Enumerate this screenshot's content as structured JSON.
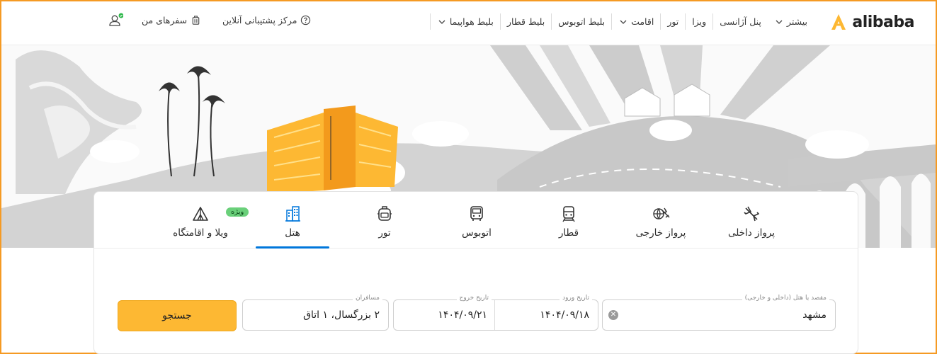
{
  "brand": {
    "name": "alibaba",
    "accent": "#fdb833"
  },
  "nav": {
    "items": [
      {
        "label": "بلیط هواپیما",
        "dropdown": true
      },
      {
        "label": "بلیط قطار",
        "dropdown": false
      },
      {
        "label": "بلیط اتوبوس",
        "dropdown": false
      },
      {
        "label": "اقامت",
        "dropdown": true
      },
      {
        "label": "تور",
        "dropdown": false
      },
      {
        "label": "ویزا",
        "dropdown": false
      },
      {
        "label": "پنل آژانسی",
        "dropdown": false
      },
      {
        "label": "بیشتر",
        "dropdown": true
      }
    ],
    "support": "مرکز پشتیبانی آنلاین",
    "trips": "سفرهای من"
  },
  "tabs": [
    {
      "id": "domestic-flight",
      "label": "پرواز داخلی",
      "icon": "plane-icon"
    },
    {
      "id": "international-flight",
      "label": "پرواز خارجی",
      "icon": "globe-plane-icon"
    },
    {
      "id": "train",
      "label": "قطار",
      "icon": "train-icon"
    },
    {
      "id": "bus",
      "label": "اتوبوس",
      "icon": "bus-icon"
    },
    {
      "id": "tour",
      "label": "تور",
      "icon": "backpack-icon"
    },
    {
      "id": "hotel",
      "label": "هتل",
      "icon": "hotel-building-icon",
      "active": true
    },
    {
      "id": "villa",
      "label": "ویلا و اقامتگاه",
      "icon": "tent-icon",
      "badge": "ویژه"
    }
  ],
  "form": {
    "destination": {
      "label": "مقصد یا هتل (داخلی و خارجی)",
      "value": "مشهد"
    },
    "checkin": {
      "label": "تاریخ ورود",
      "value": "۱۴۰۴/۰۹/۱۸"
    },
    "checkout": {
      "label": "تاریخ خروج",
      "value": "۱۴۰۴/۰۹/۲۱"
    },
    "passengers": {
      "label": "مسافران",
      "value": "۲ بزرگسال، ۱ اتاق"
    },
    "search_label": "جستجو"
  }
}
